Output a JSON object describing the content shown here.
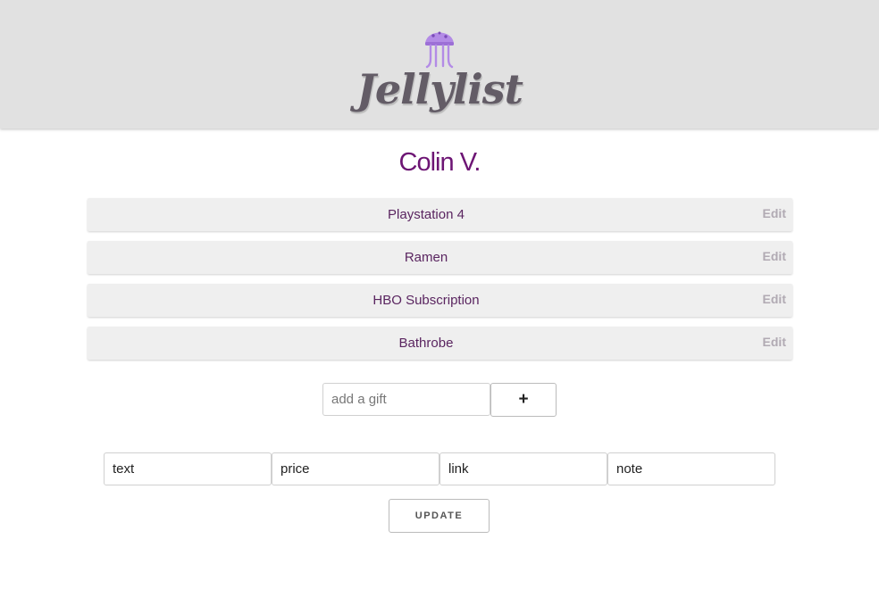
{
  "header": {
    "logo_text": "Jellylist",
    "logo_icon": "jellyfish-icon"
  },
  "user": {
    "name": "Colin V."
  },
  "gifts": [
    {
      "name": "Playstation 4",
      "edit_label": "Edit"
    },
    {
      "name": "Ramen",
      "edit_label": "Edit"
    },
    {
      "name": "HBO Subscription",
      "edit_label": "Edit"
    },
    {
      "name": "Bathrobe",
      "edit_label": "Edit"
    }
  ],
  "add_form": {
    "placeholder": "add a gift",
    "value": "",
    "button_label": "+"
  },
  "edit_form": {
    "fields": [
      {
        "placeholder": "text",
        "value": ""
      },
      {
        "placeholder": "price",
        "value": ""
      },
      {
        "placeholder": "link",
        "value": ""
      },
      {
        "placeholder": "note",
        "value": ""
      }
    ],
    "update_label": "UPDATE"
  },
  "colors": {
    "header_bg": "#e1e1e1",
    "logo_text": "#635c66",
    "jellyfish": "#b38be6",
    "user_name": "#6d1574",
    "gift_text": "#5a2560",
    "edit_text": "#b1aab3",
    "row_bg": "#efefef"
  }
}
